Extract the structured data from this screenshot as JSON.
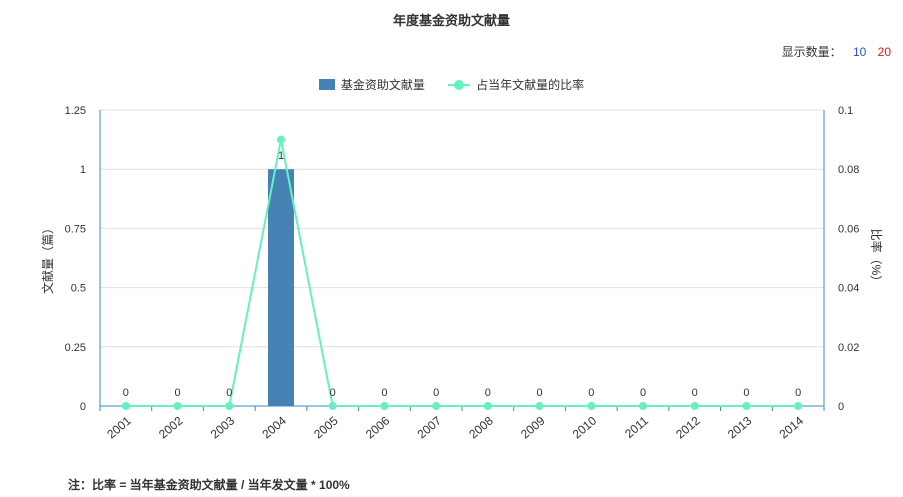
{
  "chart_data": {
    "type": "bar",
    "title": "年度基金资助文献量",
    "categories": [
      "2001",
      "2002",
      "2003",
      "2004",
      "2005",
      "2006",
      "2007",
      "2008",
      "2009",
      "2010",
      "2011",
      "2012",
      "2013",
      "2014"
    ],
    "series": [
      {
        "name": "基金资助文献量",
        "type": "bar",
        "axis": "left",
        "color": "#4682b4",
        "values": [
          0,
          0,
          0,
          1,
          0,
          0,
          0,
          0,
          0,
          0,
          0,
          0,
          0,
          0
        ],
        "data_labels": [
          "0",
          "0",
          "0",
          "1",
          "0",
          "0",
          "0",
          "0",
          "0",
          "0",
          "0",
          "0",
          "0",
          "0"
        ]
      },
      {
        "name": "占当年文献量的比率",
        "type": "line",
        "axis": "right",
        "color": "#66f0c0",
        "values": [
          0,
          0,
          0,
          0.09,
          0,
          0,
          0,
          0,
          0,
          0,
          0,
          0,
          0,
          0
        ]
      }
    ],
    "ylabel": "文献量（篇）",
    "ylim": [
      0,
      1.25
    ],
    "yticks": [
      "0",
      "0.25",
      "0.5",
      "0.75",
      "1",
      "1.25"
    ],
    "y2label": "比率（%）",
    "y2lim": [
      0,
      0.1
    ],
    "y2ticks": [
      "0",
      "0.02",
      "0.04",
      "0.06",
      "0.08",
      "0.1"
    ],
    "grid": true,
    "legend_position": "top-center"
  },
  "display_count": {
    "label": "显示数量：",
    "options": [
      "10",
      "20"
    ],
    "colors": [
      "#2a4fd6",
      "#e0161b"
    ]
  },
  "footnote": "注：比率 = 当年基金资助文献量 / 当年发文量 * 100%"
}
